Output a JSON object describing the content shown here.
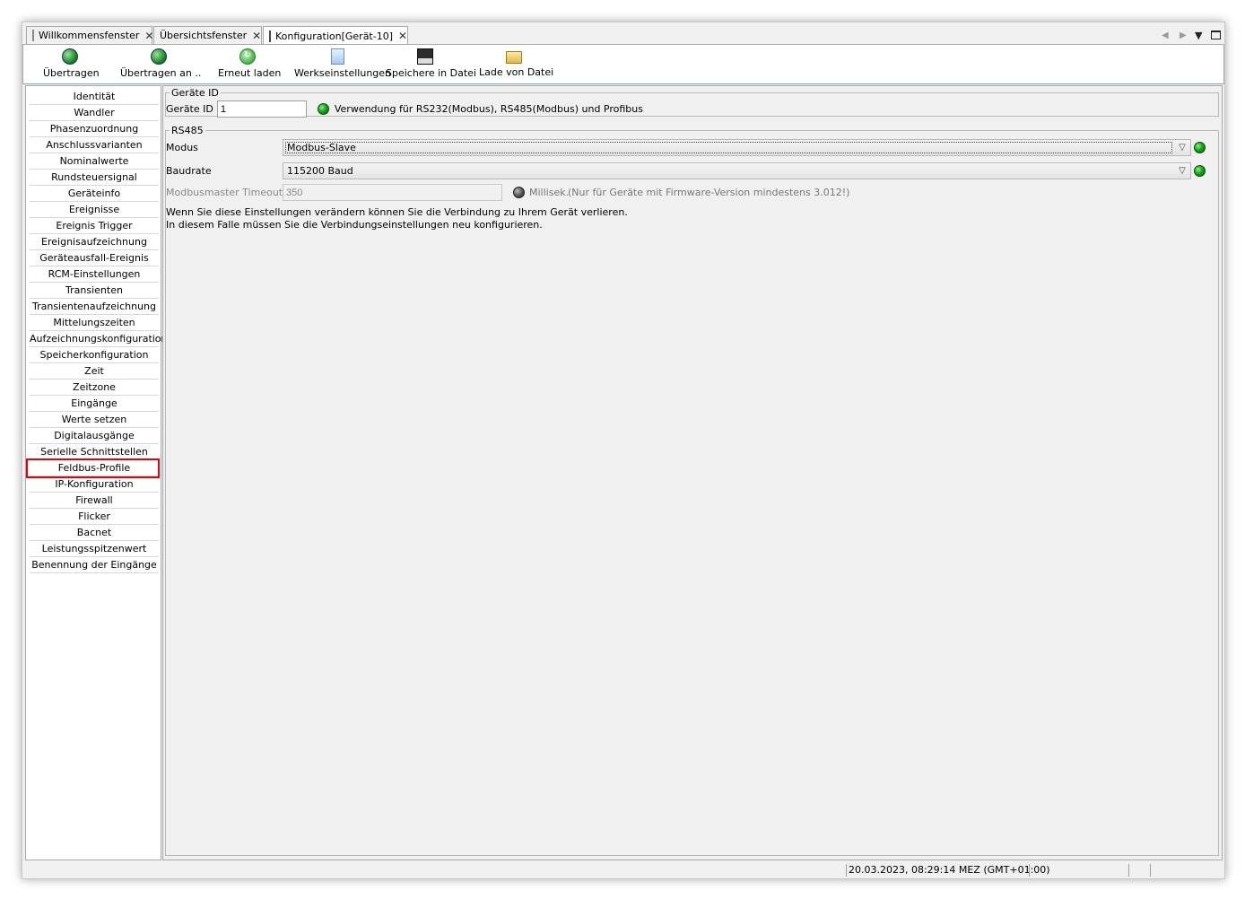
{
  "tabs": [
    {
      "label": "Willkommensfenster",
      "icon": "document-icon"
    },
    {
      "label": "Übersichtsfenster",
      "icon": ""
    },
    {
      "label": "Konfiguration[Gerät-10]",
      "icon": "device-config-icon"
    }
  ],
  "toolbar": {
    "uebertragen": "Übertragen",
    "uebertragen_an": "Übertragen an ..",
    "erneut_laden": "Erneut laden",
    "werkseinstellungen": "Werkseinstellungen",
    "speichere": "Speichere in Datei",
    "lade": "Lade von Datei"
  },
  "sidebar": {
    "items": [
      "Identität",
      "Wandler",
      "Phasenzuordnung",
      "Anschlussvarianten",
      "Nominalwerte",
      "Rundsteuersignal",
      "Geräteinfo",
      "Ereignisse",
      "Ereignis Trigger",
      "Ereignisaufzeichnung",
      "Geräteausfall-Ereignis",
      "RCM-Einstellungen",
      "Transienten",
      "Transientenaufzeichnung",
      "Mittelungszeiten",
      "Aufzeichnungskonfiguration",
      "Speicherkonfiguration",
      "Zeit",
      "Zeitzone",
      "Eingänge",
      "Werte setzen",
      "Digitalausgänge",
      "Serielle Schnittstellen",
      "Feldbus-Profile",
      "IP-Konfiguration",
      "Firewall",
      "Flicker",
      "Bacnet",
      "Leistungsspitzenwert",
      "Benennung der Eingänge"
    ],
    "selected": "Serielle Schnittstellen"
  },
  "geraete_id": {
    "legend": "Geräte ID",
    "label": "Geräte ID",
    "value": "1",
    "info": "Verwendung für RS232(Modbus), RS485(Modbus) und Profibus"
  },
  "rs485": {
    "legend": "RS485",
    "modus_label": "Modus",
    "modus_value": "Modbus-Slave",
    "baudrate_label": "Baudrate",
    "baudrate_value": "115200 Baud",
    "timeout_label": "Modbusmaster Timeout",
    "timeout_value": "350",
    "timeout_unit": "Millisek.",
    "timeout_note": "(Nur für Geräte mit Firmware-Version mindestens 3.012!)",
    "warning_line1": "Wenn Sie diese Einstellungen verändern können Sie die Verbindung zu Ihrem Gerät verlieren.",
    "warning_line2": "In diesem Falle müssen Sie die Verbindungseinstellungen neu konfigurieren."
  },
  "status": {
    "datetime": "20.03.2023, 08:29:14 MEZ (GMT+01:00)"
  },
  "colors": {
    "highlight": "#e3000f",
    "led_ok": "#19a619",
    "led_off": "#5a5a5a"
  }
}
